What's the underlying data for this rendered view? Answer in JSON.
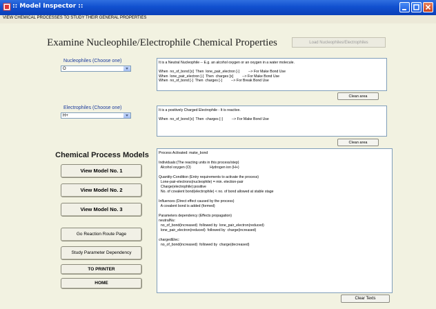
{
  "window": {
    "title": ":: Model Inspector ::",
    "subtitle": "VIEW CHEMICAL PROCESSES TO STUDY THEIR GENERAL PROPERTIES"
  },
  "header": {
    "heading": "Examine Nucleophile/Electrophile Chemical Properties",
    "load_button": "Load Nucleophiles/Electrophiles"
  },
  "nucleophiles": {
    "label": "Nucleophiles (Choose one)",
    "selected": "O",
    "text": "It is a Neutral Nucleophile -- E.g. an alcohol oxygen or an oxygen in a water molecule.\n\nWhen  no_of_bond [x]  Then  lone_pair_electron [-]         --> For Make Bond Use\nWhen  lone_pair_electron [-]  Then  charges [x]         --> For Make Bond Use\nWhen  no_of_bond [-]  Then  charges [-]         --> For Break Bond Use",
    "clean_button": "Clean area"
  },
  "electrophiles": {
    "label": "Electrophiles (Choose one)",
    "selected": "H+",
    "text": "It is a positively Charged Electrophile - It is reactive.\n\nWhen  no_of_bond [x]  Then  charges [-]         --> For Make Bond Use",
    "clean_button": "Clean area"
  },
  "models": {
    "title": "Chemical Process Models",
    "buttons": [
      "View Model No. 1",
      "View Model No. 2",
      "View Model No. 3"
    ]
  },
  "actions": {
    "reaction_route": "Go Reaction Route Page",
    "parameter_dependency": "Study Parameter Dependency",
    "printer": "TO PRINTER",
    "home": "HOME"
  },
  "process_output": {
    "text": "Process Activated: make_bond\n\nIndividuals:(The reacting units in this process/step)\n  Alcohol oxygen (O)                   Hydrogen ion (H+)\n\nQuantity-Condition (Entry requirements to activate the process)\n  Lone-pair-electrons(nucleophile) = min. election-pair\n  Charge(electrophile):positive\n  No. of covalent bond(electrophile) < no. of bond allowed at stable stage\n\nInfluences (Direct effect caused by the process)\n  A covalent bond is added (formed)\n\nParameters dependency (Effects propagation)\nneutralNu:\n  no_of_bond(increased)  followed by  lone_pair_electron(reduced)\n  lone_pair_electron(reduced)  followed by  charge(increased)\n\nchargedElec:\n  no_of_bond(increased)  followed by  charge(decreased)",
    "clear_button": "Clear Texts"
  },
  "colors": {
    "titlebar": "#1150cf",
    "background": "#f2f2e1",
    "label_blue": "#1a3a9c"
  }
}
